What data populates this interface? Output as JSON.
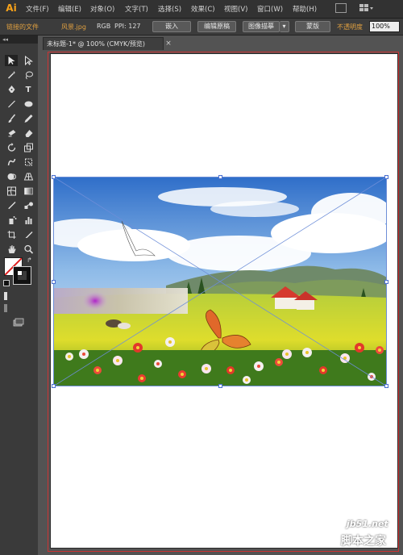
{
  "app": {
    "logo": "Ai"
  },
  "menu": [
    "文件(F)",
    "编辑(E)",
    "对象(O)",
    "文字(T)",
    "选择(S)",
    "效果(C)",
    "视图(V)",
    "窗口(W)",
    "帮助(H)"
  ],
  "control_bar": {
    "linked_file_label": "链接的文件",
    "file_name": "风景.jpg",
    "color_mode": "RGB",
    "ppi": "PPI: 127",
    "embed_button": "嵌入",
    "edit_original_button": "编辑原稿",
    "image_trace_button": "图像描摹",
    "mask_button": "蒙版",
    "opacity_label": "不透明度",
    "opacity_value": "100%"
  },
  "document": {
    "tab_title": "未标题-1* @ 100% (CMYK/预览)",
    "close_glyph": "×"
  },
  "tools": [
    "selection-tool",
    "direct-selection-tool",
    "magic-wand-tool",
    "lasso-tool",
    "pen-tool",
    "type-tool",
    "line-tool",
    "ellipse-tool",
    "paintbrush-tool",
    "pencil-tool",
    "blob-brush-tool",
    "eraser-tool",
    "rotate-tool",
    "scale-tool",
    "warp-tool",
    "free-transform-tool",
    "shape-builder-tool",
    "perspective-grid-tool",
    "mesh-tool",
    "gradient-tool",
    "eyedropper-tool",
    "blend-tool",
    "symbol-sprayer-tool",
    "column-graph-tool",
    "artboard-tool",
    "slice-tool",
    "hand-tool",
    "zoom-tool"
  ],
  "watermark": {
    "site": "jb51.net",
    "name": "脚本之家"
  },
  "colors": {
    "accent": "#f7a21a",
    "menu_bg": "#323232",
    "panel_bg": "#3a3a3a",
    "canvas_bg": "#535353",
    "selection": "#6d8ed8",
    "bleed": "#cc3333"
  }
}
